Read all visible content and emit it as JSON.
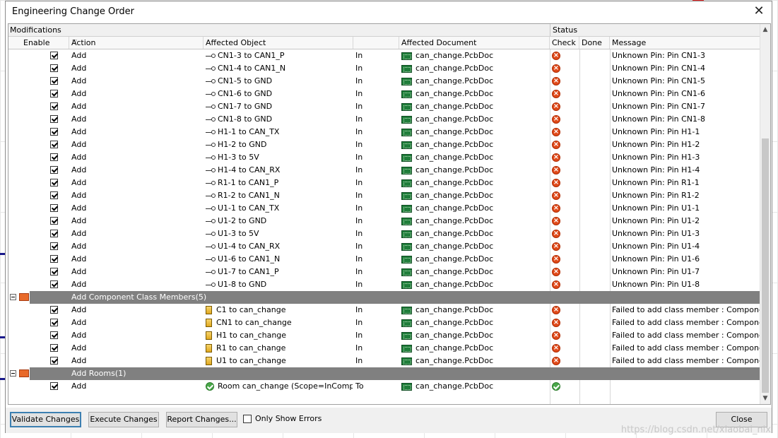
{
  "window": {
    "title": "Engineering Change Order"
  },
  "groups": {
    "modifications": "Modifications",
    "status": "Status"
  },
  "columns": {
    "enable": "Enable",
    "action": "Action",
    "affected_object": "Affected Object",
    "affected_document": "Affected Document",
    "check": "Check",
    "done": "Done",
    "message": "Message"
  },
  "rows_top": [
    {
      "action": "Add",
      "object": "CN1-3 to CAN1_P",
      "dir": "In",
      "doc": "can_change.PcbDoc",
      "message": "Unknown Pin: Pin CN1-3"
    },
    {
      "action": "Add",
      "object": "CN1-4 to CAN1_N",
      "dir": "In",
      "doc": "can_change.PcbDoc",
      "message": "Unknown Pin: Pin CN1-4"
    },
    {
      "action": "Add",
      "object": "CN1-5 to GND",
      "dir": "In",
      "doc": "can_change.PcbDoc",
      "message": "Unknown Pin: Pin CN1-5"
    },
    {
      "action": "Add",
      "object": "CN1-6 to GND",
      "dir": "In",
      "doc": "can_change.PcbDoc",
      "message": "Unknown Pin: Pin CN1-6"
    },
    {
      "action": "Add",
      "object": "CN1-7 to GND",
      "dir": "In",
      "doc": "can_change.PcbDoc",
      "message": "Unknown Pin: Pin CN1-7"
    },
    {
      "action": "Add",
      "object": "CN1-8 to GND",
      "dir": "In",
      "doc": "can_change.PcbDoc",
      "message": "Unknown Pin: Pin CN1-8"
    },
    {
      "action": "Add",
      "object": "H1-1 to CAN_TX",
      "dir": "In",
      "doc": "can_change.PcbDoc",
      "message": "Unknown Pin: Pin H1-1"
    },
    {
      "action": "Add",
      "object": "H1-2 to GND",
      "dir": "In",
      "doc": "can_change.PcbDoc",
      "message": "Unknown Pin: Pin H1-2"
    },
    {
      "action": "Add",
      "object": "H1-3 to 5V",
      "dir": "In",
      "doc": "can_change.PcbDoc",
      "message": "Unknown Pin: Pin H1-3"
    },
    {
      "action": "Add",
      "object": "H1-4 to CAN_RX",
      "dir": "In",
      "doc": "can_change.PcbDoc",
      "message": "Unknown Pin: Pin H1-4"
    },
    {
      "action": "Add",
      "object": "R1-1 to CAN1_P",
      "dir": "In",
      "doc": "can_change.PcbDoc",
      "message": "Unknown Pin: Pin R1-1"
    },
    {
      "action": "Add",
      "object": "R1-2 to CAN1_N",
      "dir": "In",
      "doc": "can_change.PcbDoc",
      "message": "Unknown Pin: Pin R1-2"
    },
    {
      "action": "Add",
      "object": "U1-1 to CAN_TX",
      "dir": "In",
      "doc": "can_change.PcbDoc",
      "message": "Unknown Pin: Pin U1-1"
    },
    {
      "action": "Add",
      "object": "U1-2 to GND",
      "dir": "In",
      "doc": "can_change.PcbDoc",
      "message": "Unknown Pin: Pin U1-2"
    },
    {
      "action": "Add",
      "object": "U1-3 to 5V",
      "dir": "In",
      "doc": "can_change.PcbDoc",
      "message": "Unknown Pin: Pin U1-3"
    },
    {
      "action": "Add",
      "object": "U1-4 to CAN_RX",
      "dir": "In",
      "doc": "can_change.PcbDoc",
      "message": "Unknown Pin: Pin U1-4"
    },
    {
      "action": "Add",
      "object": "U1-6 to CAN1_N",
      "dir": "In",
      "doc": "can_change.PcbDoc",
      "message": "Unknown Pin: Pin U1-6"
    },
    {
      "action": "Add",
      "object": "U1-7 to CAN1_P",
      "dir": "In",
      "doc": "can_change.PcbDoc",
      "message": "Unknown Pin: Pin U1-7"
    },
    {
      "action": "Add",
      "object": "U1-8 to GND",
      "dir": "In",
      "doc": "can_change.PcbDoc",
      "message": "Unknown Pin: Pin U1-8"
    }
  ],
  "group_class": {
    "label": "Add Component Class Members(5)"
  },
  "rows_class": [
    {
      "action": "Add",
      "object": "C1 to can_change",
      "dir": "In",
      "doc": "can_change.PcbDoc",
      "message": "Failed to add class member : Component"
    },
    {
      "action": "Add",
      "object": "CN1 to can_change",
      "dir": "In",
      "doc": "can_change.PcbDoc",
      "message": "Failed to add class member : Component"
    },
    {
      "action": "Add",
      "object": "H1 to can_change",
      "dir": "In",
      "doc": "can_change.PcbDoc",
      "message": "Failed to add class member : Component"
    },
    {
      "action": "Add",
      "object": "R1 to can_change",
      "dir": "In",
      "doc": "can_change.PcbDoc",
      "message": "Failed to add class member : Component"
    },
    {
      "action": "Add",
      "object": "U1 to can_change",
      "dir": "In",
      "doc": "can_change.PcbDoc",
      "message": "Failed to add class member : Component"
    }
  ],
  "group_rooms": {
    "label": "Add Rooms(1)"
  },
  "rows_rooms": [
    {
      "action": "Add",
      "object": "Room can_change (Scope=InCompor",
      "dir": "To",
      "doc": "can_change.PcbDoc",
      "message": ""
    }
  ],
  "buttons": {
    "validate": "Validate Changes",
    "execute": "Execute Changes",
    "report": "Report Changes...",
    "only_errors": "Only Show Errors",
    "close": "Close"
  },
  "watermark": "https://blog.csdn.net/xiaobai_nix"
}
